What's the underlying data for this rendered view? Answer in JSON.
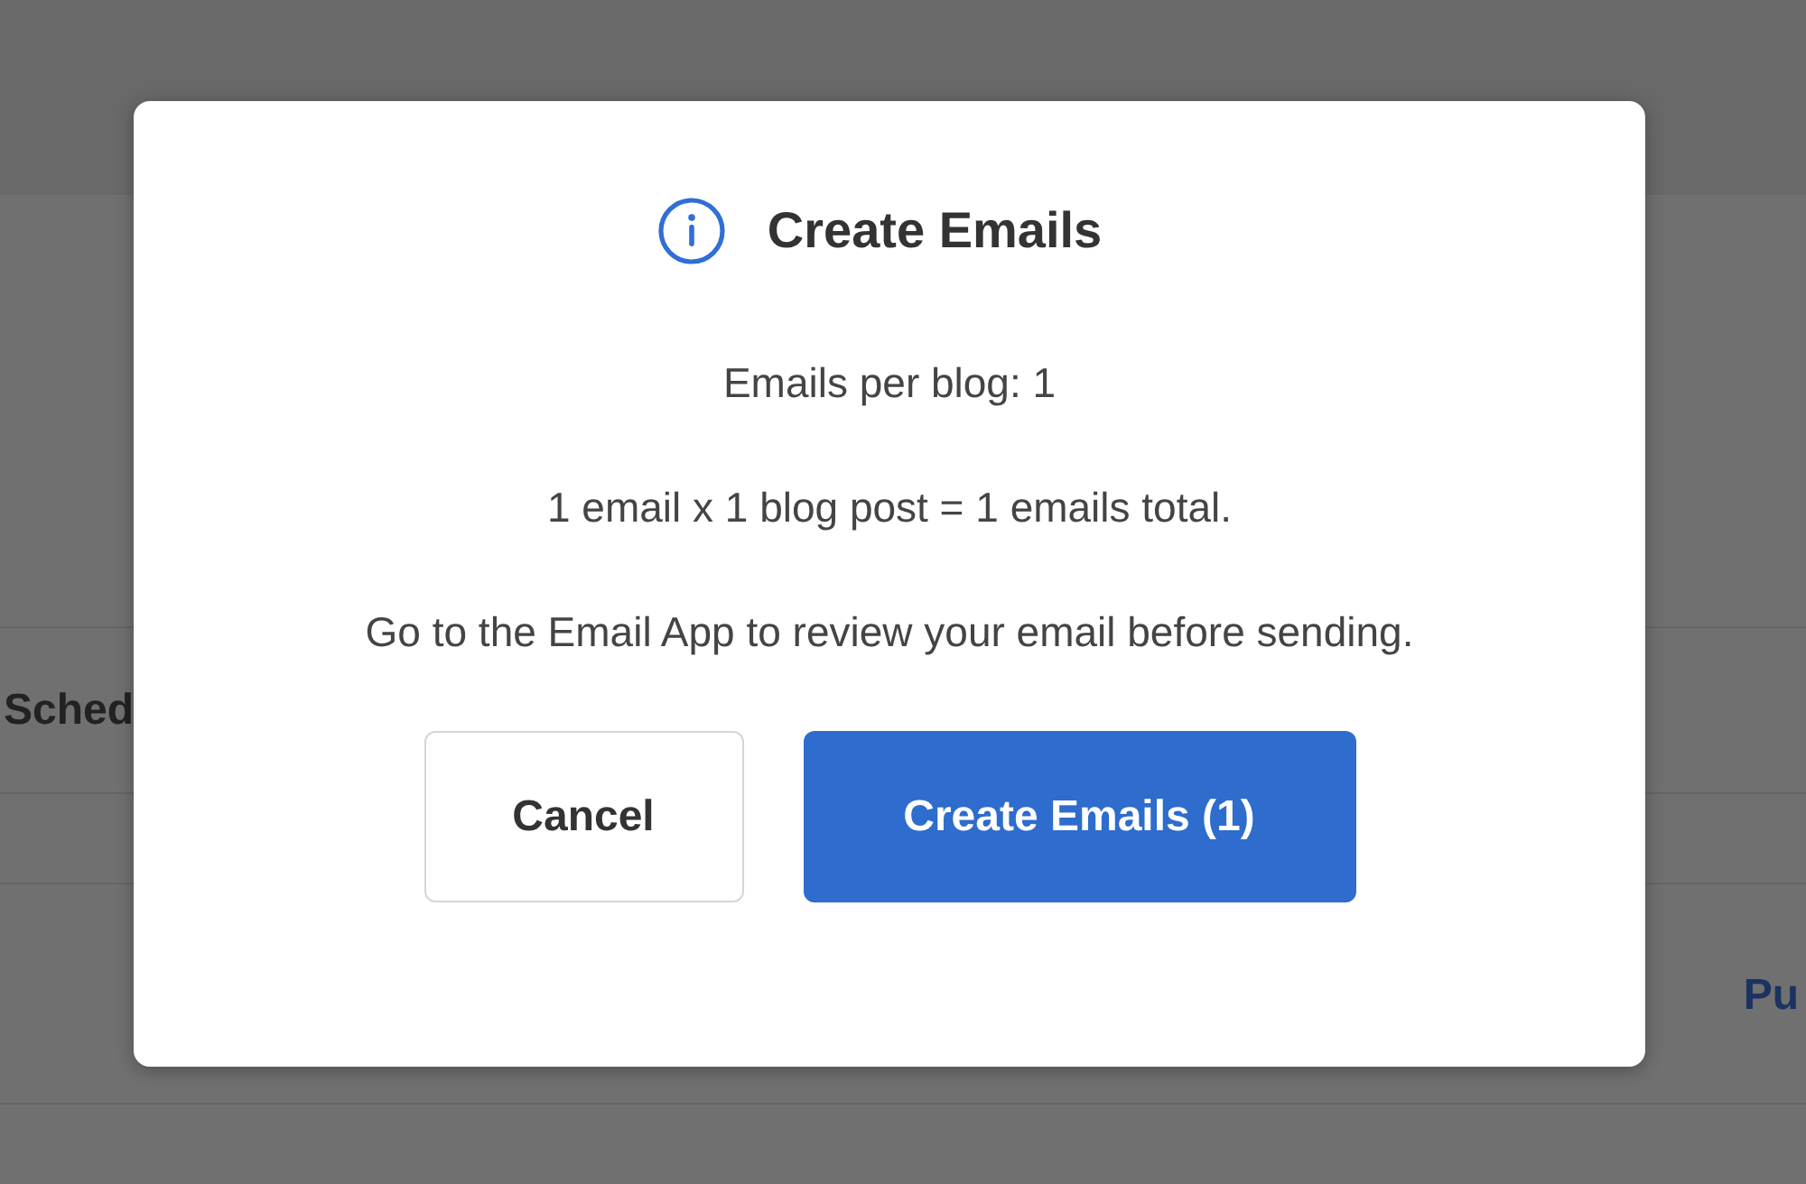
{
  "background": {
    "row_text": "Sched",
    "link_text": "Pu"
  },
  "dialog": {
    "title": "Create Emails",
    "paragraphs": [
      "Emails per blog: 1",
      "1 email x 1 blog post = 1 emails total.",
      "Go to the Email App to review your email before sending."
    ],
    "buttons": [
      {
        "label": "Cancel",
        "kind": "secondary"
      },
      {
        "label": "Create Emails (1)",
        "kind": "primary"
      }
    ]
  }
}
